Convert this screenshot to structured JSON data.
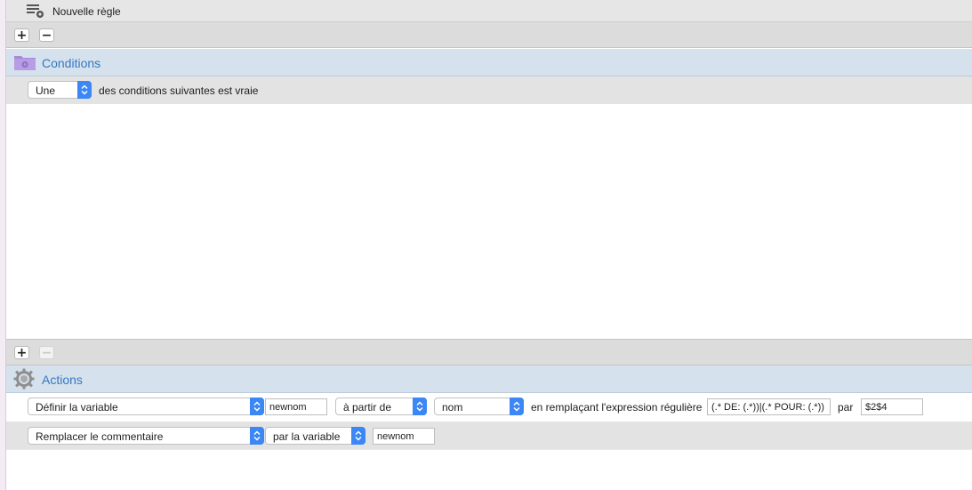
{
  "rule": {
    "title": "Nouvelle règle"
  },
  "toolbar_top": {
    "add_label": "+",
    "remove_label": "−"
  },
  "conditions": {
    "header": "Conditions",
    "match_select": "Une",
    "match_text": "des conditions suivantes est vraie",
    "add_label": "+",
    "remove_label": "−"
  },
  "actions": {
    "header": "Actions",
    "row1": {
      "action": "Définir la variable",
      "variable": "newnom",
      "source_mode": "à partir de",
      "source": "nom",
      "replace_text": "en remplaçant l'expression régulière",
      "regex": "(.* DE: (.*))|(.* POUR: (.*))",
      "par_text": "par",
      "replacement": "$2$4"
    },
    "row2": {
      "action": "Remplacer le commentaire",
      "mode": "par la variable",
      "variable": "newnom"
    }
  },
  "colors": {
    "accent": "#3b87f5",
    "header_text": "#3478c6",
    "section_bg": "#d5e1ec"
  },
  "icons": {
    "rule": "rule-settings-icon",
    "conditions": "folder-gear-icon",
    "actions": "gear-icon",
    "popup": "updown-arrows-icon"
  }
}
